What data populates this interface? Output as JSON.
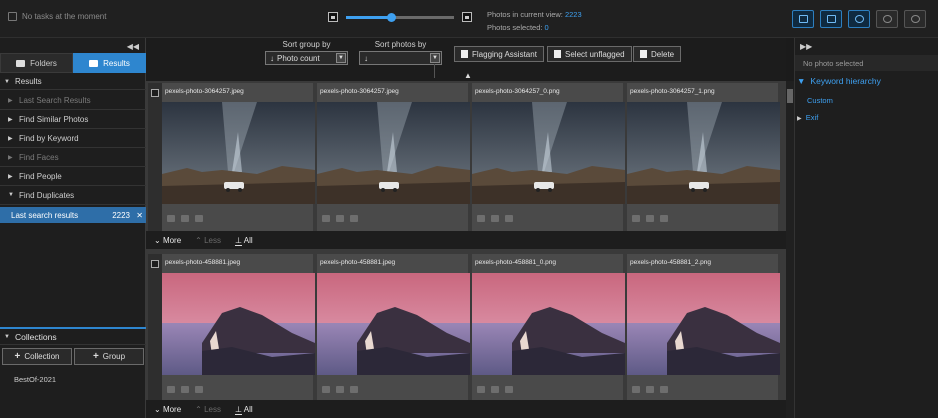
{
  "topbar": {
    "task_status": "No tasks at the moment",
    "zoom_fraction": 0.42,
    "photos_in_view_label": "Photos in current view:",
    "photos_in_view_value": "2223",
    "photos_selected_label": "Photos selected:",
    "photos_selected_value": "0",
    "tool_icons": [
      "screen-icon",
      "key-icon",
      "face-icon",
      "people-icon",
      "search-icon"
    ]
  },
  "left": {
    "tabs": {
      "folders": "Folders",
      "results": "Results"
    },
    "section": "Results",
    "items": [
      {
        "label": "Last Search Results",
        "dim": true
      },
      {
        "label": "Find Similar Photos",
        "dim": false
      },
      {
        "label": "Find by Keyword",
        "dim": false
      },
      {
        "label": "Find Faces",
        "dim": true
      },
      {
        "label": "Find People",
        "dim": false
      },
      {
        "label": "Find Duplicates",
        "dim": false
      }
    ],
    "sub_selected": {
      "label": "Last search results",
      "count": "2223"
    },
    "collections": {
      "title": "Collections",
      "add_collection": "Collection",
      "add_group": "Group",
      "items": [
        "BestOf-2021"
      ]
    }
  },
  "toolbar": {
    "sort_group_label": "Sort group by",
    "sort_group_value": "Photo count",
    "sort_photos_label": "Sort photos by",
    "sort_photos_value": "",
    "flagging": "Flagging Assistant",
    "select_unflagged": "Select unflagged",
    "delete": "Delete"
  },
  "groups": [
    {
      "files": [
        "pexels-photo-3064257.jpeg",
        "pexels-photo-3064257.jpeg",
        "pexels-photo-3064257_0.png",
        "pexels-photo-3064257_1.png"
      ],
      "scene": "night"
    },
    {
      "files": [
        "pexels-photo-458881.jpeg",
        "pexels-photo-458881.jpeg",
        "pexels-photo-458881_0.png",
        "pexels-photo-458881_2.png"
      ],
      "scene": "sunset"
    }
  ],
  "group_bar": {
    "more": "More",
    "less": "Less",
    "all": "All"
  },
  "right": {
    "no_photo": "No photo selected",
    "keyword_hierarchy": "Keyword hierarchy",
    "custom": "Custom",
    "exif": "Exif"
  },
  "colors": {
    "accent": "#2e86cf",
    "link": "#3ea0f0"
  }
}
